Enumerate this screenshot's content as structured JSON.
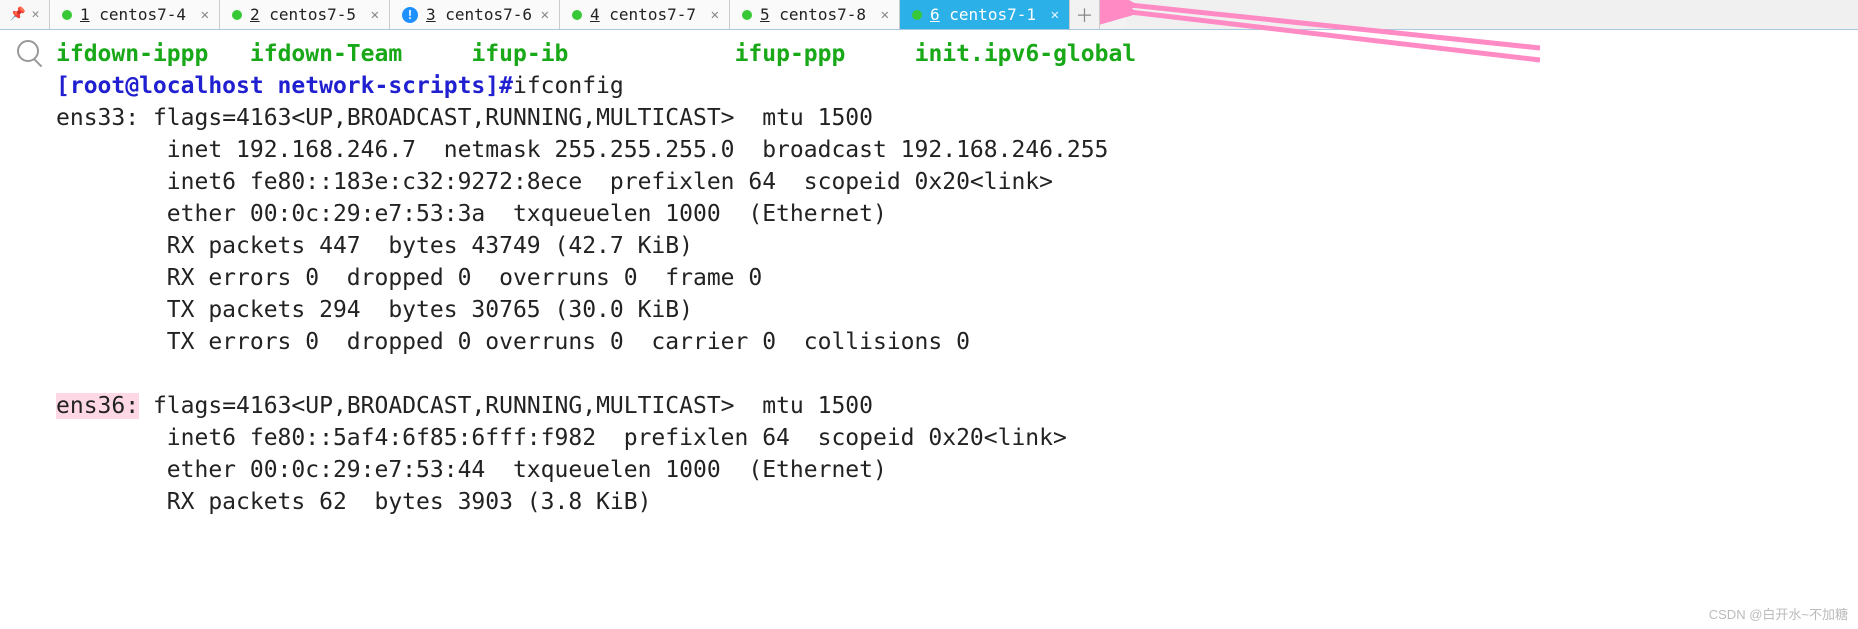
{
  "tabs": [
    {
      "num": "1",
      "label": "centos7-4",
      "status": "green"
    },
    {
      "num": "2",
      "label": "centos7-5",
      "status": "green"
    },
    {
      "num": "3",
      "label": "centos7-6",
      "status": "info"
    },
    {
      "num": "4",
      "label": "centos7-7",
      "status": "green"
    },
    {
      "num": "5",
      "label": "centos7-8",
      "status": "green"
    },
    {
      "num": "6",
      "label": "centos7-1",
      "status": "green",
      "selected": true
    }
  ],
  "ls_line": {
    "c1": "ifdown-ippp",
    "c2": "ifdown-Team",
    "c3": "ifup-ib",
    "c4": "ifup-ppp",
    "c5": "init.ipv6-global"
  },
  "prompt": "[root@localhost network-scripts]#",
  "command": "ifconfig",
  "ifconfig": {
    "ens33": {
      "name": "ens33:",
      "l1": "flags=4163<UP,BROADCAST,RUNNING,MULTICAST>  mtu 1500",
      "l2": "inet 192.168.246.7  netmask 255.255.255.0  broadcast 192.168.246.255",
      "l3": "inet6 fe80::183e:c32:9272:8ece  prefixlen 64  scopeid 0x20<link>",
      "l4": "ether 00:0c:29:e7:53:3a  txqueuelen 1000  (Ethernet)",
      "l5": "RX packets 447  bytes 43749 (42.7 KiB)",
      "l6": "RX errors 0  dropped 0  overruns 0  frame 0",
      "l7": "TX packets 294  bytes 30765 (30.0 KiB)",
      "l8": "TX errors 0  dropped 0 overruns 0  carrier 0  collisions 0"
    },
    "ens36": {
      "name": "ens36:",
      "l1": "flags=4163<UP,BROADCAST,RUNNING,MULTICAST>  mtu 1500",
      "l2": "inet6 fe80::5af4:6f85:6fff:f982  prefixlen 64  scopeid 0x20<link>",
      "l3": "ether 00:0c:29:e7:53:44  txqueuelen 1000  (Ethernet)",
      "l4": "RX packets 62  bytes 3903 (3.8 KiB)"
    }
  },
  "watermark": "CSDN @白开水~不加糖"
}
